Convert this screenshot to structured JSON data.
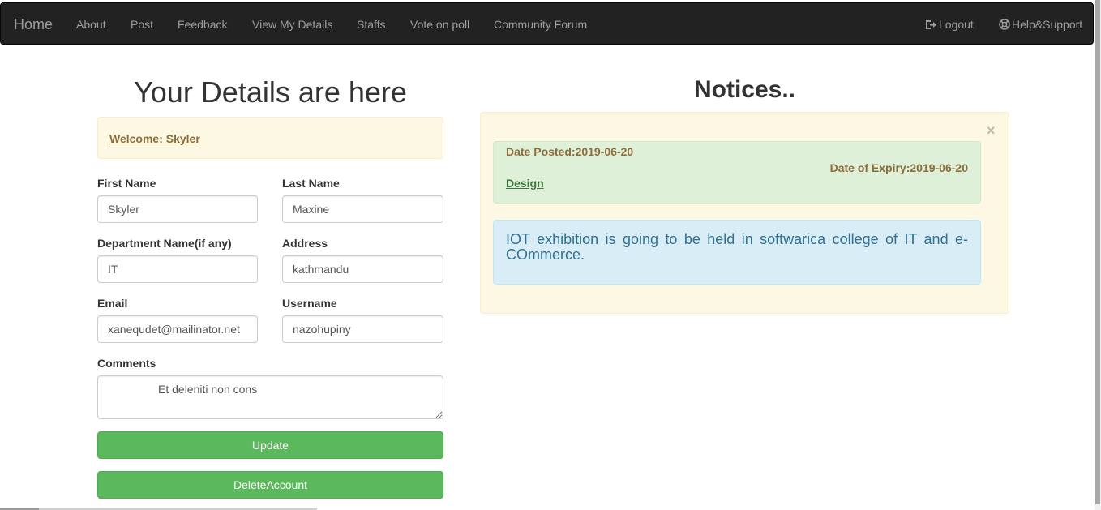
{
  "navbar": {
    "brand": "Home",
    "items": [
      "About",
      "Post",
      "Feedback",
      "View My Details",
      "Staffs",
      "Vote on poll",
      "Community Forum"
    ],
    "logout": "Logout",
    "help": "Help&Support"
  },
  "details": {
    "title": "Your Details are here",
    "welcome": "Welcome: Skyler",
    "first_name_label": "First Name",
    "first_name": "Skyler",
    "last_name_label": "Last Name",
    "last_name": "Maxine",
    "department_label": "Department Name(if any)",
    "department": "IT",
    "address_label": "Address",
    "address": "kathmandu",
    "email_label": "Email",
    "email": "xanequdet@mailinator.net",
    "username_label": "Username",
    "username": "nazohupiny",
    "comments_label": "Comments",
    "comments": "Et deleniti non cons",
    "update_label": "Update",
    "delete_label": "DeleteAccount"
  },
  "notices": {
    "title": "Notices..",
    "close": "×",
    "date_posted": "Date Posted:2019-06-20",
    "date_expiry": "Date of Expiry:2019-06-20",
    "subject": "Design",
    "body": "IOT exhibition is going to be held in softwarica college of IT and e-COmmerce."
  },
  "colors": {
    "navbar_bg": "#222222",
    "nav_text": "#9d9d9d",
    "button_green": "#5cb85c",
    "warning_bg": "#fcf8e3",
    "success_bg": "#dff0d8",
    "info_bg": "#d9edf7"
  },
  "icons": {
    "logout": "logout-icon",
    "help": "lifebuoy-icon"
  }
}
